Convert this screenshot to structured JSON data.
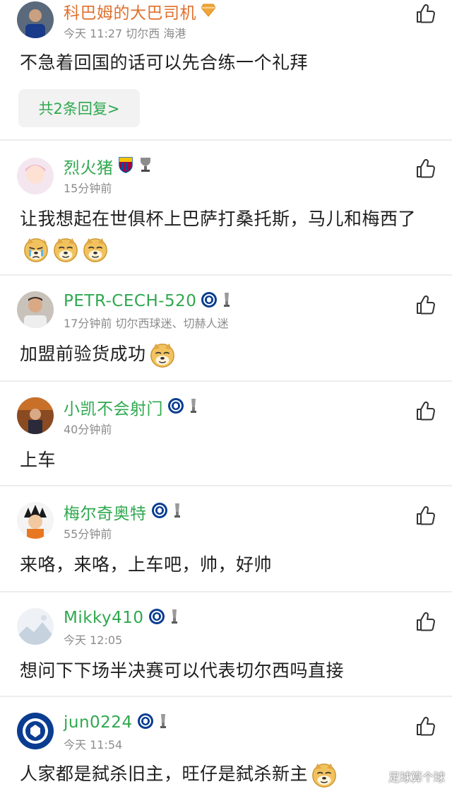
{
  "colors": {
    "username": "#2fa84f",
    "meta": "#8c8c8c",
    "divider": "#ededed",
    "reply_bg": "#f2f2f2"
  },
  "comments": [
    {
      "username": "科巴姆的大巴司机",
      "meta": "今天 11:27 切尔西 海港",
      "text": "不急着回国的话可以先合练一个礼拜",
      "replies_label": "共2条回复>",
      "badges": [
        "diamond-badge-icon"
      ]
    },
    {
      "username": "烈火猪",
      "meta": "15分钟前",
      "text": "让我想起在世俱杯上巴萨打桑托斯，马儿和梅西了",
      "badges": [
        "barcelona-badge-icon",
        "trophy-badge-icon"
      ],
      "emojis": [
        "crying-doge-emoji",
        "doge-emoji",
        "doge-emoji"
      ]
    },
    {
      "username": "PETR-CECH-520",
      "meta": "17分钟前 切尔西球迷、切赫人迷",
      "text": "加盟前验货成功",
      "badges": [
        "chelsea-badge-icon",
        "trophy-badge-icon"
      ],
      "emojis": [
        "doge-emoji"
      ]
    },
    {
      "username": "小凯不会射门",
      "meta": "40分钟前",
      "text": "上车",
      "badges": [
        "chelsea-badge-icon",
        "trophy-badge-icon"
      ]
    },
    {
      "username": "梅尔奇奥特",
      "meta": "55分钟前",
      "text": "来咯，来咯，上车吧，帅，好帅",
      "badges": [
        "chelsea-badge-icon",
        "trophy-badge-icon"
      ]
    },
    {
      "username": "Mikky410",
      "meta": "今天 12:05",
      "text": "想问下下场半决赛可以代表切尔西吗直接",
      "badges": [
        "chelsea-badge-icon",
        "trophy-badge-icon"
      ]
    },
    {
      "username": "jun0224",
      "meta": "今天 11:54",
      "text": "人家都是弑杀旧主，旺仔是弑杀新主",
      "badges": [
        "chelsea-badge-icon",
        "trophy-badge-icon"
      ],
      "emojis": [
        "doge-emoji"
      ]
    }
  ],
  "watermark": "足球算个球"
}
